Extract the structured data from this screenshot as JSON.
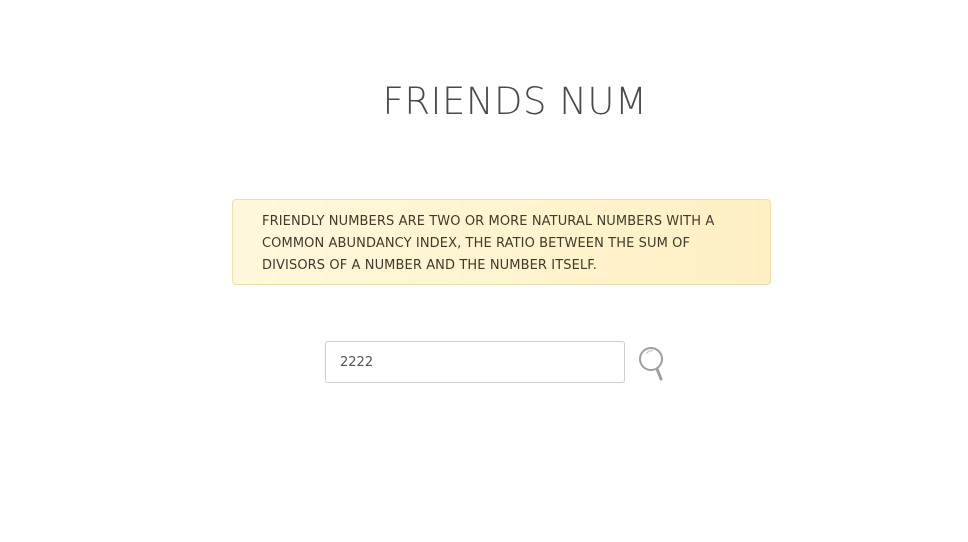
{
  "header": {
    "title": "FRIENDS NUM"
  },
  "info": {
    "text": "FRIENDLY NUMBERS ARE TWO OR MORE NATURAL NUMBERS WITH A COMMON ABUNDANCY INDEX, THE RATIO BETWEEN THE SUM OF DIVISORS OF A NUMBER AND THE NUMBER ITSELF."
  },
  "search": {
    "value": "2222",
    "icon": "search-icon"
  },
  "colors": {
    "title": "#4a4a4a",
    "info_background": "#fff4d0",
    "info_border": "#efdfa9",
    "info_text": "#3f3a2c",
    "input_border": "#cfcfcf",
    "icon": "#9e9e9e"
  }
}
